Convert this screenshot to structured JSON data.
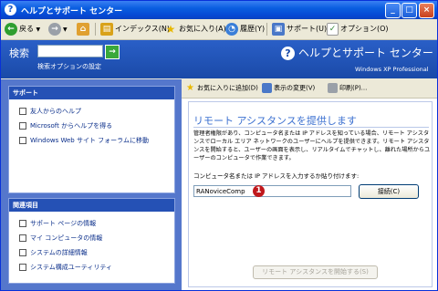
{
  "window": {
    "title": "ヘルプとサポート センター",
    "controls": {
      "minimize": "_",
      "maximize": "□",
      "close": "×"
    }
  },
  "toolbar": {
    "back": "戻る",
    "index": "インデックス(N)",
    "favorites": "お気に入り(A)",
    "history": "履歴(Y)",
    "support": "サポート(U)",
    "options": "オプション(O)"
  },
  "header": {
    "search_label": "検索",
    "search_value": "",
    "go_glyph": "→",
    "search_options": "検索オプションの設定",
    "app_title": "ヘルプとサポート センター",
    "app_subtitle": "Windows XP Professional"
  },
  "sidebar": {
    "support_panel": {
      "heading": "サポート",
      "items": [
        {
          "label": "友人からのヘルプ"
        },
        {
          "label": "Microsoft からヘルプを得る"
        },
        {
          "label": "Windows Web サイト フォーラムに移動"
        }
      ]
    },
    "related_panel": {
      "heading": "関連項目",
      "items": [
        {
          "label": "サポート ページの情報"
        },
        {
          "label": "マイ コンピュータの情報"
        },
        {
          "label": "システムの詳細情報"
        },
        {
          "label": "システム構成ユーティリティ"
        }
      ]
    }
  },
  "content_toolbar": {
    "add_favorite": "お気に入りに追加(D)",
    "change_view": "表示の変更(V)",
    "print": "印刷(P)..."
  },
  "remote_assistance": {
    "title": "リモート アシスタンスを提供します",
    "description": "管理者権限があり、コンピュータ名または IP アドレスを知っている場合、リモート アシスタンスでローカル エリア ネットワークのユーザーにヘルプを提供できます。リモート アシスタンスを開始すると、ユーザーの画面を表示し、リアルタイムでチャットし、離れた場所からユーザーのコンピュータで作業できます。",
    "prompt": "コンピュータ名または IP アドレスを入力するか貼り付けます:",
    "computer_value": "RANoviceComp",
    "badge": "1",
    "connect_label": "接続(C)",
    "start_label": "リモート アシスタンスを開始する(S)"
  },
  "colors": {
    "title_blue": "#0a5ee0",
    "header_blue": "#1a4aa8",
    "accent_red": "#c0181c",
    "link_blue": "#3a6fd0"
  }
}
